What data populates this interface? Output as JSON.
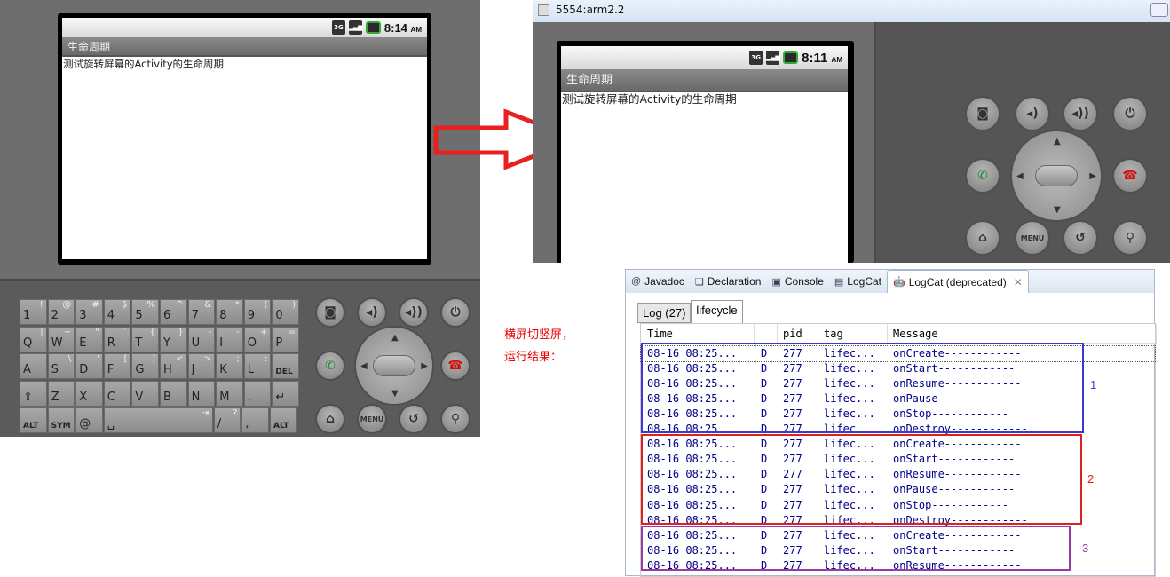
{
  "left_emulator": {
    "status_time": "8:14",
    "status_ampm": "AM",
    "net": "3G",
    "app_title": "生命周期",
    "content_text": "测试旋转屏幕的Activity的生命周期",
    "keyboard_rows": [
      [
        [
          "1",
          "!"
        ],
        [
          "2",
          "@"
        ],
        [
          "3",
          "#"
        ],
        [
          "4",
          "$"
        ],
        [
          "5",
          "%"
        ],
        [
          "6",
          "^"
        ],
        [
          "7",
          "&"
        ],
        [
          "8",
          "*"
        ],
        [
          "9",
          "("
        ],
        [
          "0",
          ")"
        ]
      ],
      [
        [
          "Q",
          "|"
        ],
        [
          "W",
          "~"
        ],
        [
          "E",
          "\""
        ],
        [
          "R",
          "`"
        ],
        [
          "T",
          "{"
        ],
        [
          "Y",
          "}"
        ],
        [
          "U",
          "-"
        ],
        [
          "I",
          "-"
        ],
        [
          "O",
          "+"
        ],
        [
          "P",
          "="
        ]
      ],
      [
        [
          "A",
          ""
        ],
        [
          "S",
          "\\"
        ],
        [
          "D",
          "'"
        ],
        [
          "F",
          "["
        ],
        [
          "G",
          "]"
        ],
        [
          "H",
          "<"
        ],
        [
          "J",
          ">"
        ],
        [
          "K",
          ";"
        ],
        [
          "L",
          ":"
        ],
        [
          "DEL",
          ""
        ]
      ],
      [
        [
          "⇧",
          ""
        ],
        [
          "Z",
          ""
        ],
        [
          "X",
          ""
        ],
        [
          "C",
          ""
        ],
        [
          "V",
          ""
        ],
        [
          "B",
          ""
        ],
        [
          "N",
          ""
        ],
        [
          "M",
          ""
        ],
        [
          ".",
          ""
        ],
        [
          "↵",
          ""
        ]
      ],
      [
        [
          "ALT",
          ""
        ],
        [
          "SYM",
          ""
        ],
        [
          "@",
          ""
        ],
        [
          "␣",
          "⇥"
        ],
        [
          "/",
          "?"
        ],
        [
          ",",
          ""
        ],
        [
          "ALT",
          ""
        ]
      ]
    ],
    "menu_label": "MENU"
  },
  "right_window": {
    "title": "5554:arm2.2",
    "status_time": "8:11",
    "status_ampm": "AM",
    "net": "3G",
    "app_title": "生命周期",
    "content_text": "测试旋转屏幕的Activity的生命周期",
    "menu_label": "MENU"
  },
  "annotation": {
    "line1": "横屏切竖屏，",
    "line2": "运行结果：",
    "color": "#e00000"
  },
  "logcat": {
    "tabs": [
      {
        "label": "Javadoc",
        "icon": "at-icon"
      },
      {
        "label": "Declaration",
        "icon": "declaration-icon"
      },
      {
        "label": "Console",
        "icon": "console-icon"
      },
      {
        "label": "LogCat",
        "icon": "logcat-icon"
      },
      {
        "label": "LogCat (deprecated)",
        "icon": "android-icon",
        "active": true
      }
    ],
    "subtabs": [
      {
        "label": "Log (27)"
      },
      {
        "label": "lifecycle",
        "active": true
      }
    ],
    "columns": [
      "Time",
      "",
      "pid",
      "tag",
      "Message"
    ],
    "rows": [
      [
        "08-16 08:25...",
        "D",
        "277",
        "lifec...",
        "onCreate------------"
      ],
      [
        "08-16 08:25...",
        "D",
        "277",
        "lifec...",
        "onStart------------"
      ],
      [
        "08-16 08:25...",
        "D",
        "277",
        "lifec...",
        "onResume------------"
      ],
      [
        "08-16 08:25...",
        "D",
        "277",
        "lifec...",
        "onPause------------"
      ],
      [
        "08-16 08:25...",
        "D",
        "277",
        "lifec...",
        "onStop------------"
      ],
      [
        "08-16 08:25...",
        "D",
        "277",
        "lifec...",
        "onDestroy------------"
      ],
      [
        "08-16 08:25...",
        "D",
        "277",
        "lifec...",
        "onCreate------------"
      ],
      [
        "08-16 08:25...",
        "D",
        "277",
        "lifec...",
        "onStart------------"
      ],
      [
        "08-16 08:25...",
        "D",
        "277",
        "lifec...",
        "onResume------------"
      ],
      [
        "08-16 08:25...",
        "D",
        "277",
        "lifec...",
        "onPause------------"
      ],
      [
        "08-16 08:25...",
        "D",
        "277",
        "lifec...",
        "onStop------------"
      ],
      [
        "08-16 08:25...",
        "D",
        "277",
        "lifec...",
        "onDestroy------------"
      ],
      [
        "08-16 08:25...",
        "D",
        "277",
        "lifec...",
        "onCreate------------"
      ],
      [
        "08-16 08:25...",
        "D",
        "277",
        "lifec...",
        "onStart------------"
      ],
      [
        "08-16 08:25...",
        "D",
        "277",
        "lifec...",
        "onResume------------"
      ]
    ]
  },
  "groups": [
    {
      "label": "1",
      "color": "#3a3ad0"
    },
    {
      "label": "2",
      "color": "#e02020"
    },
    {
      "label": "3",
      "color": "#9a3aa8"
    }
  ]
}
